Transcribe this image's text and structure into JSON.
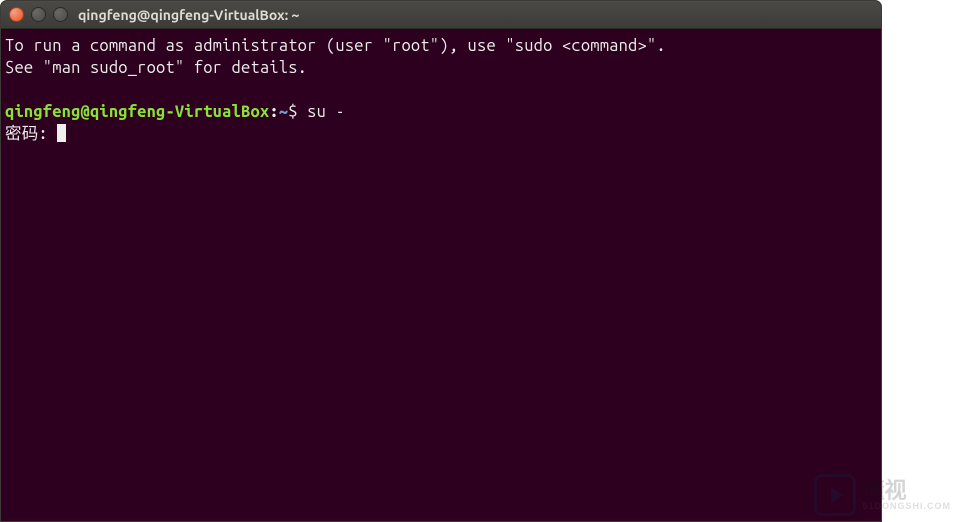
{
  "window": {
    "title": "qingfeng@qingfeng-VirtualBox: ~"
  },
  "terminal": {
    "info_line_1": "To run a command as administrator (user \"root\"), use \"sudo <command>\".",
    "info_line_2": "See \"man sudo_root\" for details.",
    "prompt": {
      "user_host": "qingfeng@qingfeng-VirtualBox",
      "colon": ":",
      "path": "~",
      "suffix": "$ "
    },
    "command": "su -",
    "password_prompt": "密码: "
  },
  "watermark": {
    "text": "懂视",
    "sub": "51DONGSHI.COM"
  }
}
